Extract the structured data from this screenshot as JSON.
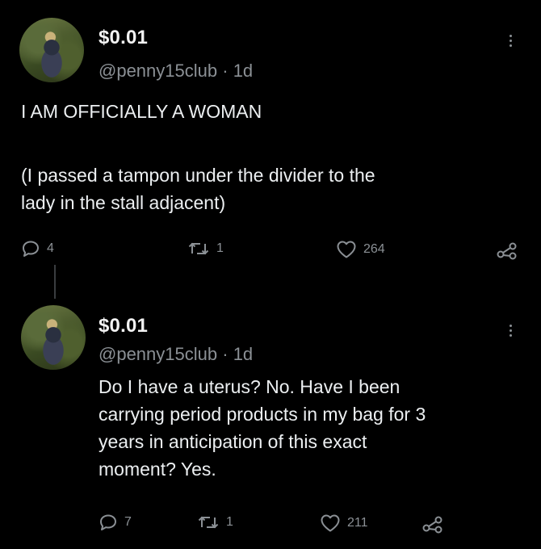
{
  "tweets": [
    {
      "display_name": "$0.01",
      "handle": "@penny15club",
      "time": "1d",
      "body_line1": "I AM OFFICIALLY A WOMAN",
      "body_line2": "(I passed a tampon under the divider to the\nlady in the stall adjacent)",
      "replies": "4",
      "retweets": "1",
      "likes": "264"
    },
    {
      "display_name": "$0.01",
      "handle": "@penny15club",
      "time": "1d",
      "body": "Do I have a uterus? No. Have I been\ncarrying period products in my bag for 3\nyears in anticipation of this exact\nmoment? Yes.",
      "replies": "7",
      "retweets": "1",
      "likes": "211"
    }
  ],
  "separator": "·",
  "icons": {
    "reply": "reply-icon",
    "retweet": "retweet-icon",
    "like": "heart-icon",
    "share": "share-icon",
    "more": "more-icon"
  },
  "colors": {
    "background": "#000000",
    "text": "#e7e9ea",
    "secondary": "#8b9095"
  }
}
